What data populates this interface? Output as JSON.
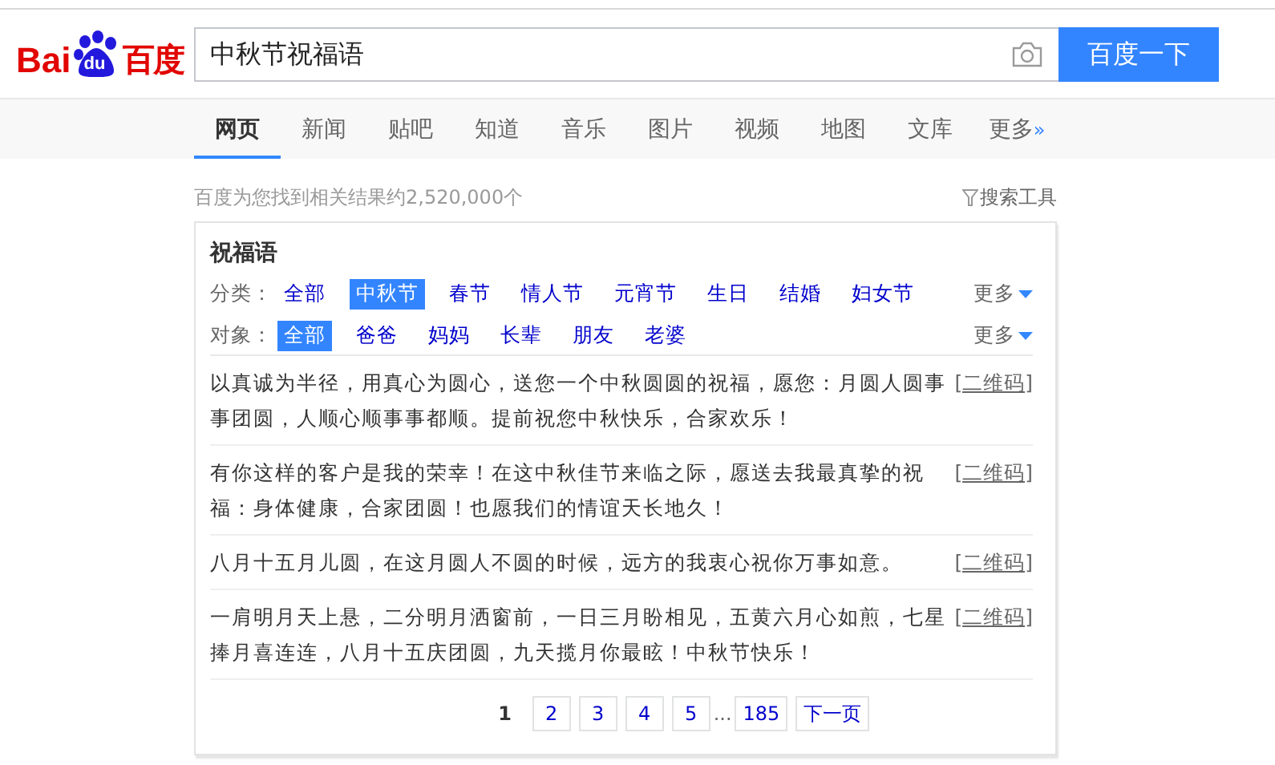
{
  "logo": {
    "left": "Bai",
    "paw": "du",
    "right": "百度"
  },
  "search": {
    "value": "中秋节祝福语",
    "button": "百度一下"
  },
  "tabs": [
    {
      "label": "网页",
      "selected": true
    },
    {
      "label": "新闻",
      "selected": false
    },
    {
      "label": "贴吧",
      "selected": false
    },
    {
      "label": "知道",
      "selected": false
    },
    {
      "label": "音乐",
      "selected": false
    },
    {
      "label": "图片",
      "selected": false
    },
    {
      "label": "视频",
      "selected": false
    },
    {
      "label": "地图",
      "selected": false
    },
    {
      "label": "文库",
      "selected": false
    },
    {
      "label": "更多",
      "selected": false,
      "suffix": "»"
    }
  ],
  "result_count": "百度为您找到相关结果约2,520,000个",
  "search_tools": "搜索工具",
  "card": {
    "title": "祝福语",
    "filters": [
      {
        "label": "分类：",
        "more": "更多",
        "options": [
          {
            "label": "全部",
            "selected": false
          },
          {
            "label": "中秋节",
            "selected": true
          },
          {
            "label": "春节",
            "selected": false
          },
          {
            "label": "情人节",
            "selected": false
          },
          {
            "label": "元宵节",
            "selected": false
          },
          {
            "label": "生日",
            "selected": false
          },
          {
            "label": "结婚",
            "selected": false
          },
          {
            "label": "妇女节",
            "selected": false
          }
        ]
      },
      {
        "label": "对象：",
        "more": "更多",
        "options": [
          {
            "label": "全部",
            "selected": true
          },
          {
            "label": "爸爸",
            "selected": false
          },
          {
            "label": "妈妈",
            "selected": false
          },
          {
            "label": "长辈",
            "selected": false
          },
          {
            "label": "朋友",
            "selected": false
          },
          {
            "label": "老婆",
            "selected": false
          }
        ]
      }
    ],
    "entries": [
      {
        "text": "以真诚为半径，用真心为圆心，送您一个中秋圆圆的祝福，愿您：月圆人圆事事团圆，人顺心顺事事都顺。提前祝您中秋快乐，合家欢乐！",
        "link": "[二维码]"
      },
      {
        "text": "有你这样的客户是我的荣幸！在这中秋佳节来临之际，愿送去我最真挚的祝福：身体健康，合家团圆！也愿我们的情谊天长地久！",
        "link": "[二维码]"
      },
      {
        "text": "八月十五月儿圆，在这月圆人不圆的时候，远方的我衷心祝你万事如意。",
        "link": "[二维码]"
      },
      {
        "text": "一肩明月天上悬，二分明月洒窗前，一日三月盼相见，五黄六月心如煎，七星捧月喜连连，八月十五庆团圆，九天揽月你最眩！中秋节快乐！",
        "link": "[二维码]"
      }
    ],
    "pagination": [
      {
        "kind": "page",
        "label": "1",
        "selected": true
      },
      {
        "kind": "page",
        "label": "2",
        "selected": false
      },
      {
        "kind": "page",
        "label": "3",
        "selected": false
      },
      {
        "kind": "page",
        "label": "4",
        "selected": false
      },
      {
        "kind": "page",
        "label": "5",
        "selected": false
      },
      {
        "kind": "ellipsis",
        "label": "..."
      },
      {
        "kind": "page",
        "label": "185",
        "selected": false
      },
      {
        "kind": "next",
        "label": "下一页"
      }
    ]
  }
}
